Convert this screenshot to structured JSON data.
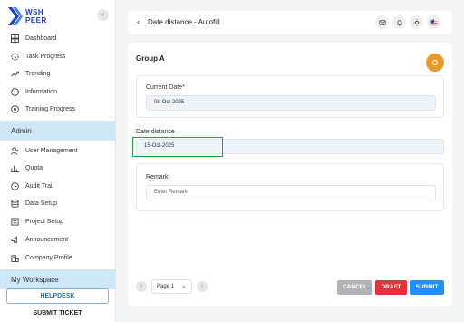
{
  "logo": {
    "line1": "WSH",
    "line2": "PEER"
  },
  "sidebar": {
    "collapse_glyph": "‹",
    "items": [
      {
        "label": "Dashboard",
        "icon": "dashboard-icon"
      },
      {
        "label": "Task Progress",
        "icon": "task-progress-icon"
      },
      {
        "label": "Trending",
        "icon": "trending-icon"
      },
      {
        "label": "Information",
        "icon": "information-icon"
      },
      {
        "label": "Training Progress",
        "icon": "training-progress-icon"
      }
    ],
    "admin_section": "Admin",
    "admin_items": [
      {
        "label": "User Management",
        "icon": "user-management-icon"
      },
      {
        "label": "Quota",
        "icon": "quota-icon"
      },
      {
        "label": "Audit Trail",
        "icon": "audit-trail-icon"
      },
      {
        "label": "Data Setup",
        "icon": "data-setup-icon"
      },
      {
        "label": "Project Setup",
        "icon": "project-setup-icon"
      },
      {
        "label": "Announcement",
        "icon": "announcement-icon"
      },
      {
        "label": "Company Profile",
        "icon": "company-profile-icon"
      }
    ],
    "workspace_section": "My Workspace",
    "helpdesk_label": "HELPDESK",
    "submit_ticket_label": "SUBMIT TICKET"
  },
  "header": {
    "back_glyph": "‹",
    "title": "Date distance - Autofill"
  },
  "main": {
    "group_title": "Group A",
    "current_date": {
      "label": "Current Date*",
      "value": "08-Oct-2025"
    },
    "date_distance": {
      "label": "Date distance",
      "value": "15-Oct-2025"
    },
    "remark": {
      "label": "Remark",
      "placeholder": "Enter Remark"
    }
  },
  "pagination": {
    "prev_glyph": "‹",
    "page_label": "Page 1",
    "next_glyph": "›",
    "chevron": "⌄"
  },
  "actions": {
    "cancel": "CANCEL",
    "draft": "DRAFT",
    "submit": "SUBMIT"
  },
  "colors": {
    "accent": "#1e90ff",
    "draft": "#e0333c",
    "cancel": "#b0b4b8",
    "section_highlight": "#cfe6f7",
    "orange_action": "#e89a2c",
    "highlight_box": "#21a336"
  }
}
